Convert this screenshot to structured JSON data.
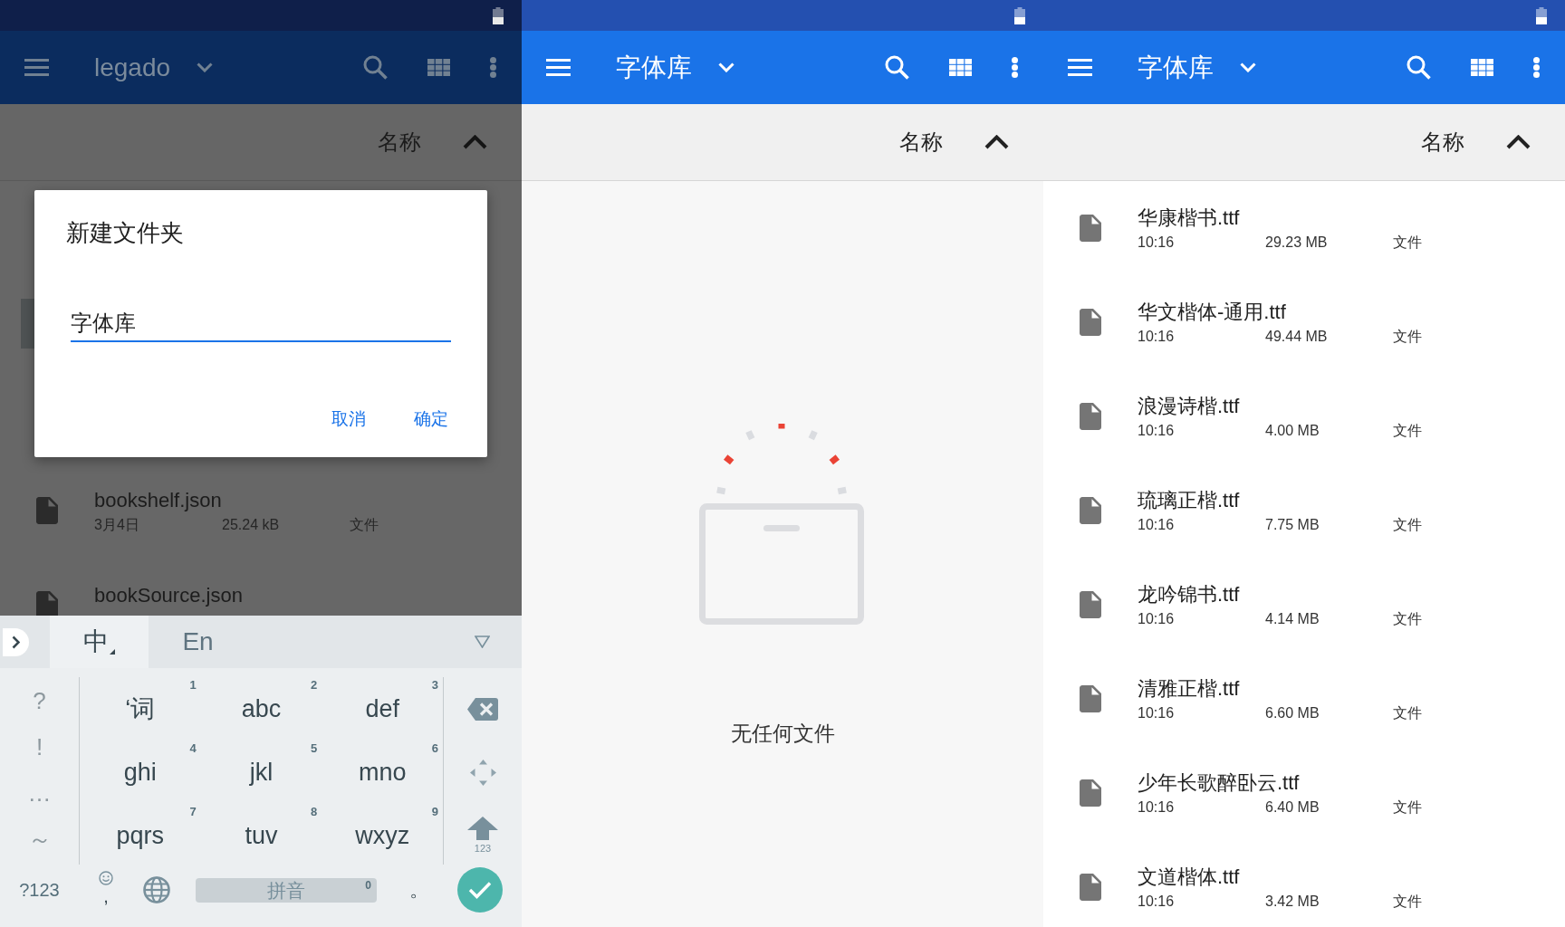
{
  "screens": [
    {
      "dimmed": true,
      "toolbar": {
        "title": "legado"
      },
      "sort_header": {
        "label": "名称",
        "ascending": true
      },
      "content": {
        "kind": "list",
        "files": [
          {
            "name": "bookshelf.json",
            "modified": "3月4日",
            "size": "25.24 kB",
            "type": "文件"
          },
          {
            "name": "bookSource.json"
          }
        ]
      },
      "dialog": {
        "title": "新建文件夹",
        "field": {
          "value": "字体库"
        },
        "buttons": [
          "取消",
          "确定"
        ]
      },
      "keyboard": {
        "tabs": [
          {
            "label": "中",
            "selected": true
          },
          {
            "label": "En",
            "selected": false
          }
        ],
        "symbols": [
          "?",
          "!",
          "…",
          "～"
        ],
        "keys": [
          {
            "label": "‘词",
            "number": "1"
          },
          {
            "label": "abc",
            "number": "2"
          },
          {
            "label": "def",
            "number": "3"
          },
          {
            "label": "ghi",
            "number": "4"
          },
          {
            "label": "jkl",
            "number": "5"
          },
          {
            "label": "mno",
            "number": "6"
          },
          {
            "label": "pqrs",
            "number": "7"
          },
          {
            "label": "tuv",
            "number": "8"
          },
          {
            "label": "wxyz",
            "number": "9"
          }
        ],
        "shift_label": "123",
        "mode_key": "?123",
        "comma": ",",
        "space": {
          "label": "拼音",
          "number": "0"
        },
        "period": "。"
      }
    },
    {
      "dimmed": false,
      "toolbar": {
        "title": "字体库"
      },
      "sort_header": {
        "label": "名称",
        "ascending": true
      },
      "content": {
        "kind": "empty",
        "message": "无任何文件"
      }
    },
    {
      "dimmed": false,
      "toolbar": {
        "title": "字体库"
      },
      "sort_header": {
        "label": "名称",
        "ascending": true
      },
      "content": {
        "kind": "list",
        "files": [
          {
            "name": "华康楷书.ttf",
            "modified": "10:16",
            "size": "29.23 MB",
            "type": "文件"
          },
          {
            "name": "华文楷体-通用.ttf",
            "modified": "10:16",
            "size": "49.44 MB",
            "type": "文件"
          },
          {
            "name": "浪漫诗楷.ttf",
            "modified": "10:16",
            "size": "4.00 MB",
            "type": "文件"
          },
          {
            "name": "琉璃正楷.ttf",
            "modified": "10:16",
            "size": "7.75 MB",
            "type": "文件"
          },
          {
            "name": "龙吟锦书.ttf",
            "modified": "10:16",
            "size": "4.14 MB",
            "type": "文件"
          },
          {
            "name": "清雅正楷.ttf",
            "modified": "10:16",
            "size": "6.60 MB",
            "type": "文件"
          },
          {
            "name": "少年长歌醉卧云.ttf",
            "modified": "10:16",
            "size": "6.40 MB",
            "type": "文件"
          },
          {
            "name": "文道楷体.ttf",
            "modified": "10:16",
            "size": "3.42 MB",
            "type": "文件"
          }
        ]
      }
    }
  ]
}
